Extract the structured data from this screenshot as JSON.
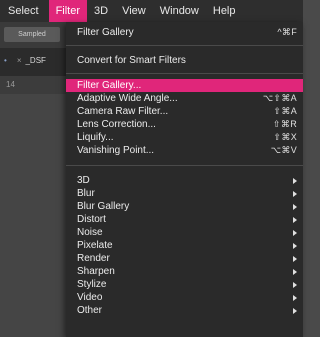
{
  "menubar": {
    "items": [
      "Select",
      "Filter",
      "3D",
      "View",
      "Window",
      "Help"
    ],
    "active_index": 1
  },
  "app": {
    "sampled_label": "Sampled",
    "doc_tab_label": "_DSF",
    "ruler_value": "14"
  },
  "filter_menu": {
    "group1": [
      {
        "label": "Filter Gallery",
        "shortcut": "^⌘F"
      },
      {
        "label": "Convert for Smart Filters",
        "shortcut": ""
      }
    ],
    "group2": [
      {
        "label": "Filter Gallery...",
        "shortcut": "",
        "highlighted": true
      },
      {
        "label": "Adaptive Wide Angle...",
        "shortcut": "⌥⇧⌘A"
      },
      {
        "label": "Camera Raw Filter...",
        "shortcut": "⇧⌘A"
      },
      {
        "label": "Lens Correction...",
        "shortcut": "⇧⌘R"
      },
      {
        "label": "Liquify...",
        "shortcut": "⇧⌘X"
      },
      {
        "label": "Vanishing Point...",
        "shortcut": "⌥⌘V"
      }
    ],
    "group3": [
      "3D",
      "Blur",
      "Blur Gallery",
      "Distort",
      "Noise",
      "Pixelate",
      "Render",
      "Sharpen",
      "Stylize",
      "Video",
      "Other"
    ]
  },
  "colors": {
    "accent": "#e0267a",
    "menu_bg": "#2a2a2a",
    "menubar_bg": "#2e2e2e"
  }
}
